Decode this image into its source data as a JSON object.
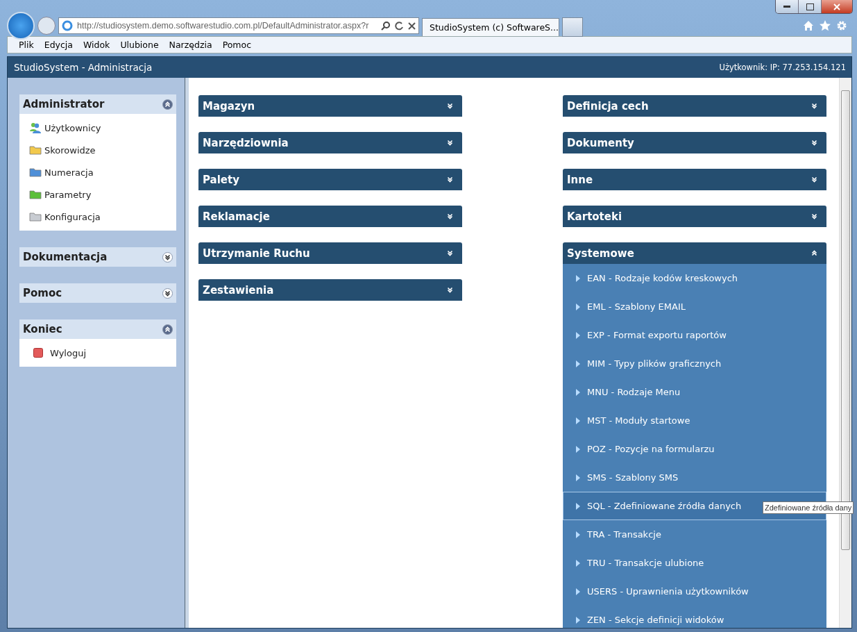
{
  "browser": {
    "address": "http://studiosystem.demo.softwarestudio.com.pl/DefaultAdministrator.aspx?r",
    "tab_title": "StudioSystem (c) SoftwareS..."
  },
  "menu": [
    "Plik",
    "Edycja",
    "Widok",
    "Ulubione",
    "Narzędzia",
    "Pomoc"
  ],
  "header": {
    "title": "StudioSystem - Administracja",
    "user": "Użytkownik: IP: 77.253.154.121"
  },
  "sidebar": [
    {
      "title": "Administrator",
      "expanded": true,
      "items": [
        {
          "label": "Użytkownicy",
          "kind": "users"
        },
        {
          "label": "Skorowidze",
          "kind": "folder",
          "color": "#f2c94c"
        },
        {
          "label": "Numeracja",
          "kind": "folder",
          "color": "#4f8fd8"
        },
        {
          "label": "Parametry",
          "kind": "folder",
          "color": "#5cbf3a"
        },
        {
          "label": "Konfiguracja",
          "kind": "folder",
          "color": "#c8ccd2"
        }
      ]
    },
    {
      "title": "Dokumentacja",
      "expanded": false
    },
    {
      "title": "Pomoc",
      "expanded": false
    },
    {
      "title": "Koniec",
      "expanded": true,
      "items": [
        {
          "label": "Wyloguj",
          "kind": "logout"
        }
      ]
    }
  ],
  "columns": [
    [
      {
        "title": "Magazyn",
        "expanded": false
      },
      {
        "title": "Narzędziownia",
        "expanded": false
      },
      {
        "title": "Palety",
        "expanded": false
      },
      {
        "title": "Reklamacje",
        "expanded": false
      },
      {
        "title": "Utrzymanie Ruchu",
        "expanded": false
      },
      {
        "title": "Zestawienia",
        "expanded": false
      }
    ],
    [
      {
        "title": "Definicja cech",
        "expanded": false
      },
      {
        "title": "Dokumenty",
        "expanded": false
      },
      {
        "title": "Inne",
        "expanded": false
      },
      {
        "title": "Kartoteki",
        "expanded": false
      },
      {
        "title": "Systemowe",
        "expanded": true,
        "items": [
          {
            "label": "EAN - Rodzaje kodów kreskowych",
            "selected": false
          },
          {
            "label": "EML - Szablony EMAIL",
            "selected": false
          },
          {
            "label": "EXP - Format exportu raportów",
            "selected": false
          },
          {
            "label": "MIM - Typy plików graficznych",
            "selected": false
          },
          {
            "label": "MNU - Rodzaje Menu",
            "selected": false
          },
          {
            "label": "MST - Moduły startowe",
            "selected": false
          },
          {
            "label": "POZ - Pozycje na formularzu",
            "selected": false
          },
          {
            "label": "SMS - Szablony SMS",
            "selected": false
          },
          {
            "label": "SQL - Zdefiniowane źródła danych",
            "selected": true,
            "tooltip": "Zdefiniowane źródła dany"
          },
          {
            "label": "TRA - Transakcje",
            "selected": false
          },
          {
            "label": "TRU - Transakcje ulubione",
            "selected": false
          },
          {
            "label": "USERS - Uprawnienia użytkowników",
            "selected": false
          },
          {
            "label": "ZEN - Sekcje definicji widoków",
            "selected": false
          }
        ]
      }
    ]
  ]
}
